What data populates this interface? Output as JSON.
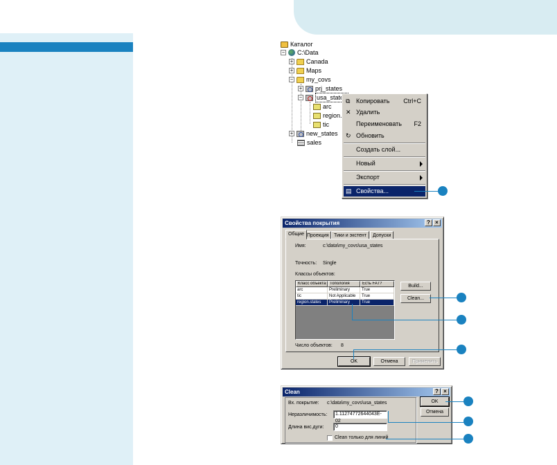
{
  "tree": {
    "root": "Каталог",
    "drive": "C:\\Data",
    "items": [
      {
        "label": "Canada"
      },
      {
        "label": "Maps"
      },
      {
        "label": "my_covs"
      },
      {
        "label": "prj_states"
      },
      {
        "label": "usa_states"
      },
      {
        "label": "arc"
      },
      {
        "label": "region.:"
      },
      {
        "label": "tic"
      },
      {
        "label": "new_states"
      },
      {
        "label": "sales"
      }
    ]
  },
  "context_menu": {
    "items": [
      {
        "label": "Копировать",
        "shortcut": "Ctrl+C"
      },
      {
        "label": "Удалить"
      },
      {
        "label": "Переименовать",
        "shortcut": "F2"
      },
      {
        "label": "Обновить"
      },
      {
        "label": "Создать слой..."
      },
      {
        "label": "Новый"
      },
      {
        "label": "Экспорт"
      },
      {
        "label": "Свойства..."
      }
    ]
  },
  "props_dialog": {
    "title": "Свойства покрытия",
    "tabs": [
      "Общие",
      "Проекция",
      "Тики и экстент",
      "Допуски"
    ],
    "name_label": "Имя:",
    "name_value": "c:\\data\\my_covs\\usa_states",
    "precision_label": "Точность:",
    "precision_value": "Single",
    "classes_label": "Классы объектов:",
    "columns": [
      "Класс объекта",
      "Топология",
      "Есть FAT?"
    ],
    "rows": [
      [
        "arc",
        "Preliminary",
        "True"
      ],
      [
        "tic",
        "Not Applicable",
        "True"
      ],
      [
        "region.states",
        "Preliminary",
        "True"
      ]
    ],
    "build_label": "Build...",
    "clean_label": "Clean...",
    "count_label": "Число объектов:",
    "count_value": "8",
    "ok_label": "OK",
    "cancel_label": "Отмена",
    "apply_label": "Применить"
  },
  "clean_dialog": {
    "title": "Clean",
    "input_label": "Вх. покрытие:",
    "input_value": "c:\\data\\my_covs\\usa_states",
    "fuzzy_label": "Неразличимость:",
    "fuzzy_value": "1.11274772644043E-02",
    "dangle_label": "Длина вис.дуги:",
    "dangle_value": "0",
    "lines_only_label": "Clean только для линий",
    "ok_label": "OK",
    "cancel_label": "Отмена"
  },
  "colors": {
    "accent": "#1a82c0",
    "sidebar": "#dff0f7",
    "selection": "#0a246a",
    "window": "#d4d0c8"
  }
}
